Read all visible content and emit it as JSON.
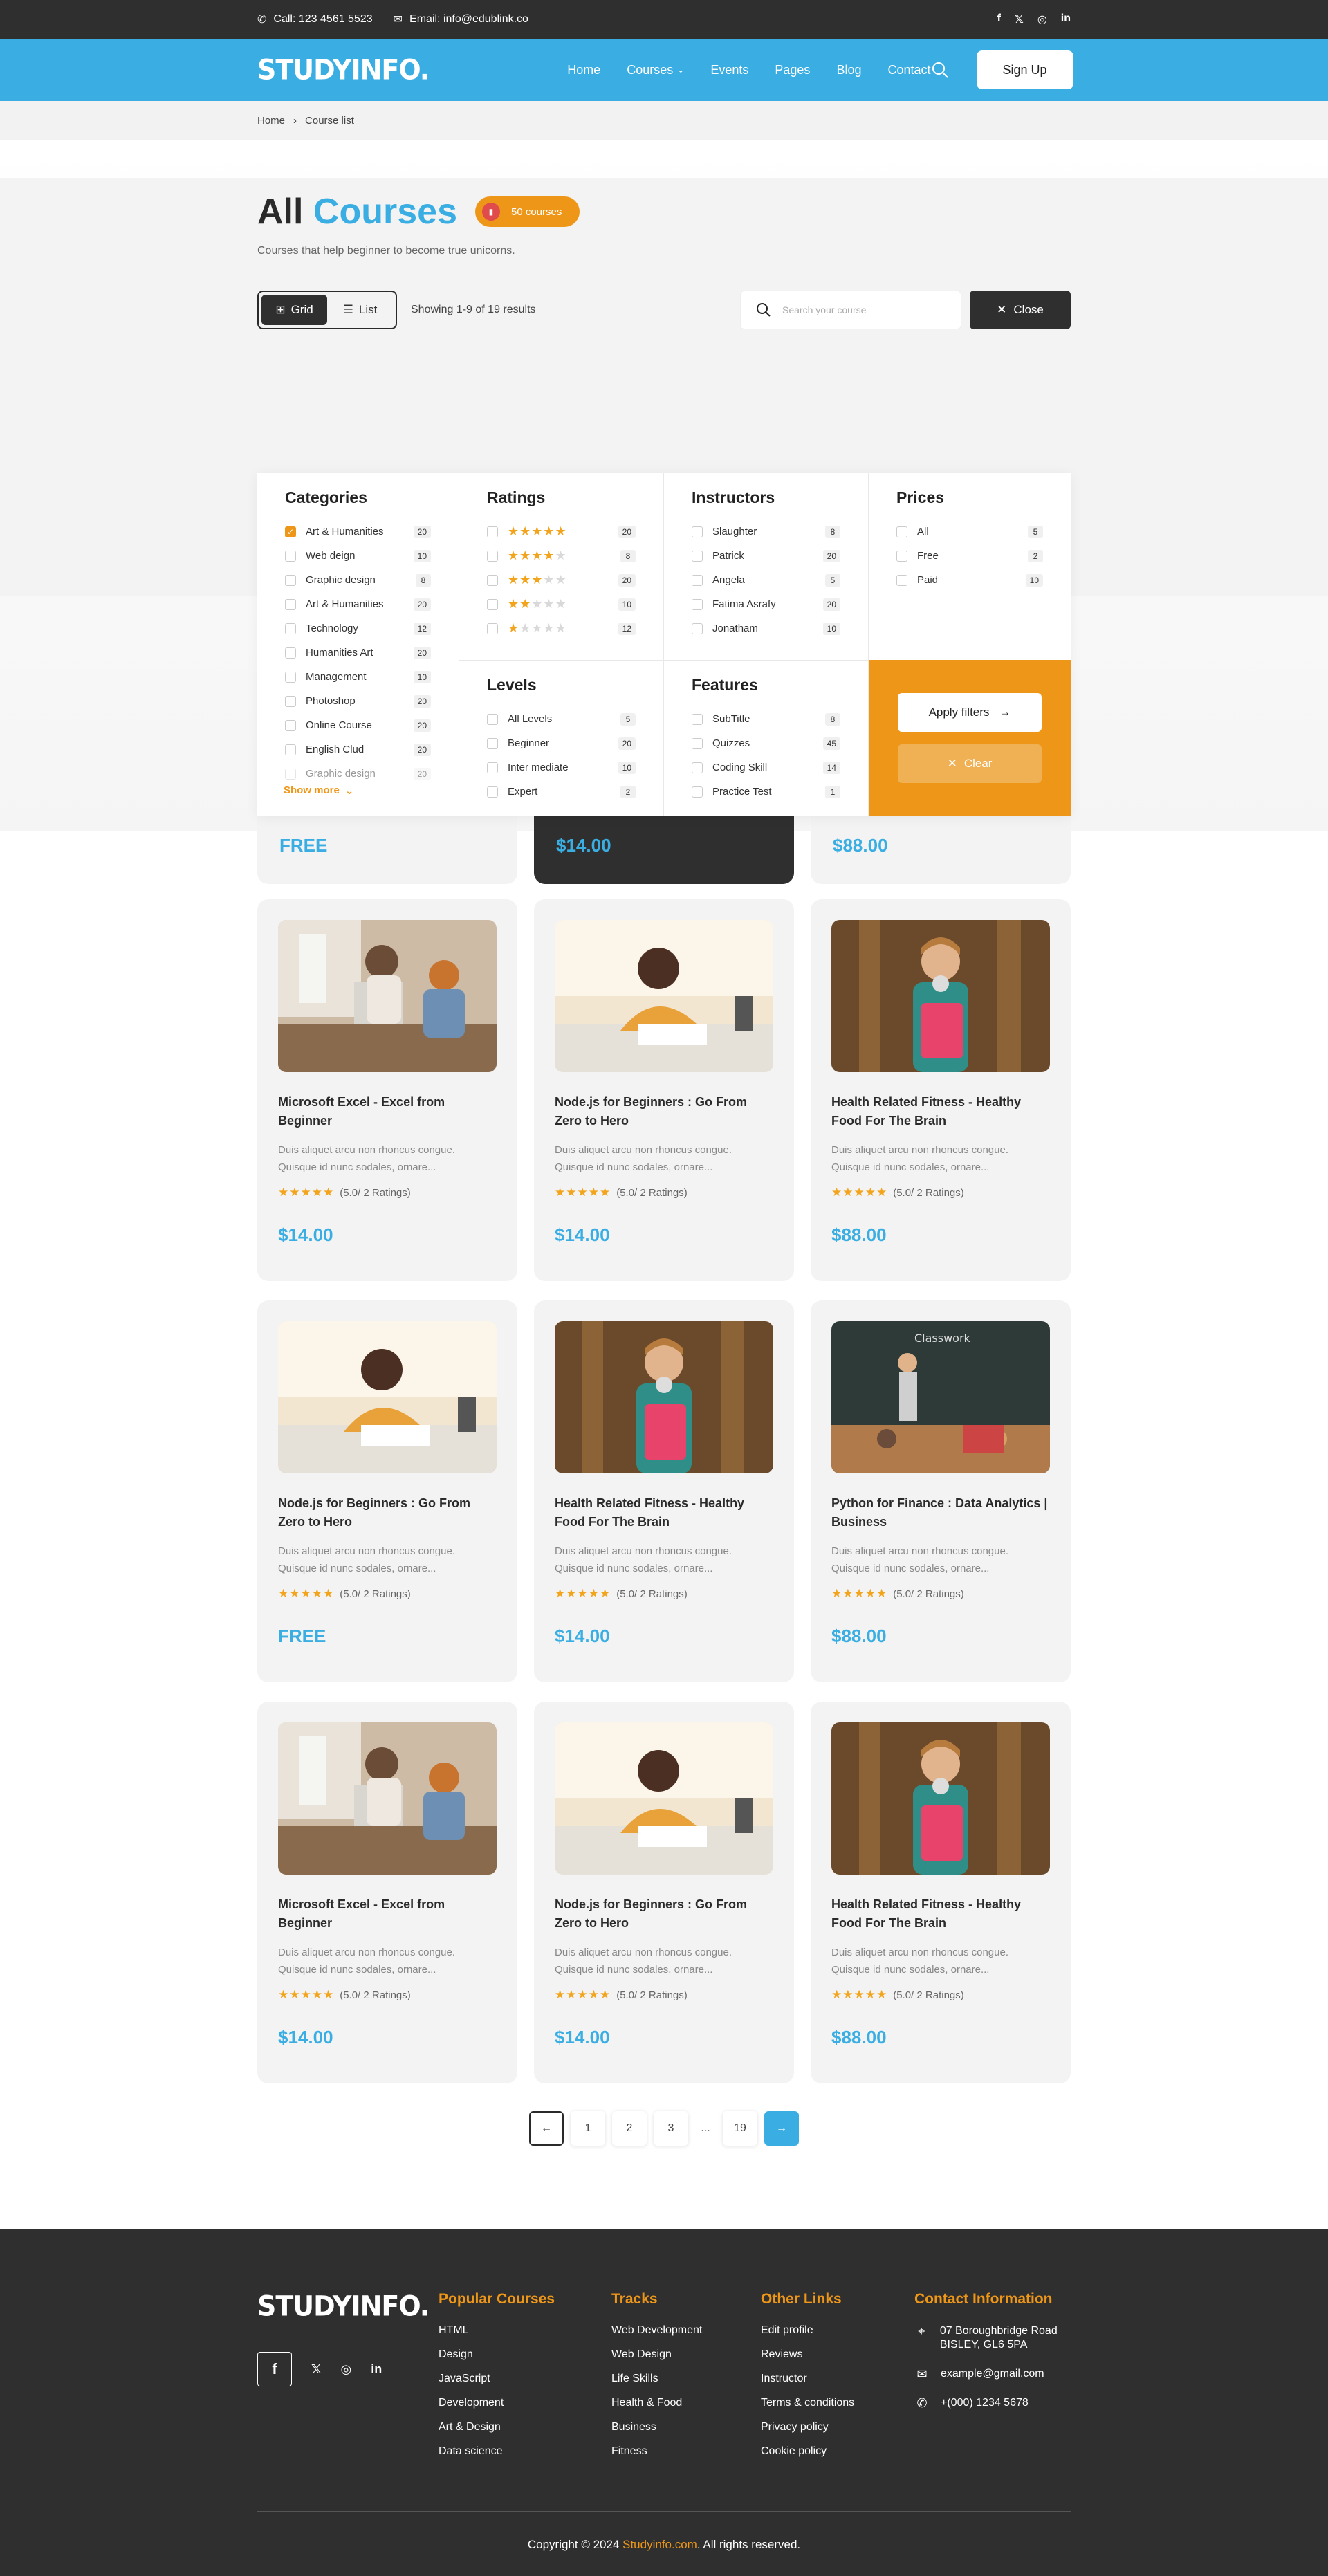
{
  "topbar": {
    "call": "Call: 123 4561 5523",
    "email": "Email: info@edublink.co",
    "social_icons": [
      "facebook-icon",
      "x-icon",
      "instagram-icon",
      "linkedin-icon"
    ]
  },
  "header": {
    "logo": "STUDYINFO.",
    "nav": [
      "Home",
      "Courses",
      "Events",
      "Pages",
      "Blog",
      "Contact"
    ],
    "signup": "Sign Up"
  },
  "breadcrumb": {
    "home": "Home",
    "current": "Course list"
  },
  "hero": {
    "title_plain": "All",
    "title_accent": "Courses",
    "badge": "50 courses",
    "subtitle": "Courses that help beginner to become true unicorns."
  },
  "toolbar": {
    "grid_label": "Grid",
    "list_label": "List",
    "results": "Showing 1-9 of 19 results",
    "search_placeholder": "Search your course",
    "close_label": "Close"
  },
  "filters": {
    "categories": {
      "title": "Categories",
      "items": [
        {
          "label": "Art & Humanities",
          "count": "20",
          "checked": true
        },
        {
          "label": "Web deign",
          "count": "10"
        },
        {
          "label": "Graphic design",
          "count": "8"
        },
        {
          "label": "Art & Humanities",
          "count": "20"
        },
        {
          "label": "Technology",
          "count": "12"
        },
        {
          "label": "Humanities Art",
          "count": "20"
        },
        {
          "label": "Management",
          "count": "10"
        },
        {
          "label": "Photoshop",
          "count": "20"
        },
        {
          "label": "Online Course",
          "count": "20"
        },
        {
          "label": "English Clud",
          "count": "20"
        },
        {
          "label": "Graphic design",
          "count": "20"
        }
      ],
      "show_more": "Show more"
    },
    "ratings": {
      "title": "Ratings",
      "items": [
        {
          "stars": 5,
          "count": "20"
        },
        {
          "stars": 4,
          "count": "8"
        },
        {
          "stars": 3,
          "count": "20"
        },
        {
          "stars": 2,
          "count": "10"
        },
        {
          "stars": 1,
          "count": "12"
        }
      ]
    },
    "instructors": {
      "title": "Instructors",
      "items": [
        {
          "label": "Slaughter",
          "count": "8"
        },
        {
          "label": "Patrick",
          "count": "20"
        },
        {
          "label": "Angela",
          "count": "5"
        },
        {
          "label": "Fatima Asrafy",
          "count": "20"
        },
        {
          "label": "Jonatham",
          "count": "10"
        }
      ]
    },
    "prices": {
      "title": "Prices",
      "items": [
        {
          "label": "All",
          "count": "5"
        },
        {
          "label": "Free",
          "count": "2"
        },
        {
          "label": "Paid",
          "count": "10"
        }
      ]
    },
    "levels": {
      "title": "Levels",
      "items": [
        {
          "label": "All Levels",
          "count": "5"
        },
        {
          "label": "Beginner",
          "count": "20"
        },
        {
          "label": "Inter mediate",
          "count": "10"
        },
        {
          "label": "Expert",
          "count": "2"
        }
      ]
    },
    "features": {
      "title": "Features",
      "items": [
        {
          "label": "SubTitle",
          "count": "8"
        },
        {
          "label": "Quizzes",
          "count": "45"
        },
        {
          "label": "Coding Skill",
          "count": "14"
        },
        {
          "label": "Practice Test",
          "count": "1"
        }
      ]
    },
    "apply_label": "Apply filters",
    "clear_label": "Clear"
  },
  "partial_prices": [
    "FREE",
    "$14.00",
    "$88.00"
  ],
  "courses": [
    {
      "img": "tutor",
      "title": "Microsoft Excel - Excel from Beginner",
      "desc": "Duis aliquet arcu non rhoncus congue. Quisque id nunc sodales, ornare...",
      "rating": "(5.0/ 2 Ratings)",
      "price": "$14.00"
    },
    {
      "img": "writing",
      "title": "Node.js for Beginners : Go From Zero to Hero",
      "desc": "Duis aliquet arcu non rhoncus congue. Quisque id nunc sodales, ornare...",
      "rating": "(5.0/ 2 Ratings)",
      "price": "$14.00"
    },
    {
      "img": "student",
      "title": "Health Related Fitness - Healthy Food For The Brain",
      "desc": "Duis aliquet arcu non rhoncus congue. Quisque id nunc sodales, ornare...",
      "rating": "(5.0/ 2 Ratings)",
      "price": "$88.00"
    },
    {
      "img": "writing",
      "title": "Node.js for Beginners : Go From Zero to Hero",
      "desc": "Duis aliquet arcu non rhoncus congue. Quisque id nunc sodales, ornare...",
      "rating": "(5.0/ 2 Ratings)",
      "price": "FREE"
    },
    {
      "img": "student",
      "title": "Health Related Fitness - Healthy Food For The Brain",
      "desc": "Duis aliquet arcu non rhoncus congue. Quisque id nunc sodales, ornare...",
      "rating": "(5.0/ 2 Ratings)",
      "price": "$14.00"
    },
    {
      "img": "classroom",
      "title": "Python for Finance : Data Analytics | Business",
      "desc": "Duis aliquet arcu non rhoncus congue. Quisque id nunc sodales, ornare...",
      "rating": "(5.0/ 2 Ratings)",
      "price": "$88.00"
    },
    {
      "img": "tutor",
      "title": "Microsoft Excel - Excel from Beginner",
      "desc": "Duis aliquet arcu non rhoncus congue. Quisque id nunc sodales, ornare...",
      "rating": "(5.0/ 2 Ratings)",
      "price": "$14.00"
    },
    {
      "img": "writing",
      "title": "Node.js for Beginners : Go From Zero to Hero",
      "desc": "Duis aliquet arcu non rhoncus congue. Quisque id nunc sodales, ornare...",
      "rating": "(5.0/ 2 Ratings)",
      "price": "$14.00"
    },
    {
      "img": "student",
      "title": "Health Related Fitness - Healthy Food For The Brain",
      "desc": "Duis aliquet arcu non rhoncus congue. Quisque id nunc sodales, ornare...",
      "rating": "(5.0/ 2 Ratings)",
      "price": "$88.00"
    }
  ],
  "pagination": {
    "pages": [
      "1",
      "2",
      "3"
    ],
    "dots": "...",
    "last": "19"
  },
  "footer": {
    "logo": "STUDYINFO.",
    "columns": [
      {
        "title": "Popular Courses",
        "links": [
          "HTML",
          "Design",
          "JavaScript",
          "Development",
          "Art & Design",
          "Data science"
        ]
      },
      {
        "title": "Tracks",
        "links": [
          "Web Development",
          "Web Design",
          "Life Skills",
          "Health & Food",
          "Business",
          "Fitness"
        ]
      },
      {
        "title": "Other Links",
        "links": [
          "Edit profile",
          "Reviews",
          "Instructor",
          "Terms & conditions",
          "Privacy policy",
          "Cookie policy"
        ]
      }
    ],
    "contact": {
      "title": "Contact Information",
      "address": "07 Boroughbridge Road BISLEY, GL6 5PA",
      "email": "example@gmail.com",
      "phone": "+(000) 1234 5678"
    },
    "copyright_prefix": "Copyright © 2024",
    "copyright_brand": "Studyinfo.com",
    "copyright_suffix": ". All rights reserved."
  },
  "colors": {
    "primary": "#3aaee3",
    "accent": "#ee9617",
    "dark": "#2f2f2f"
  }
}
